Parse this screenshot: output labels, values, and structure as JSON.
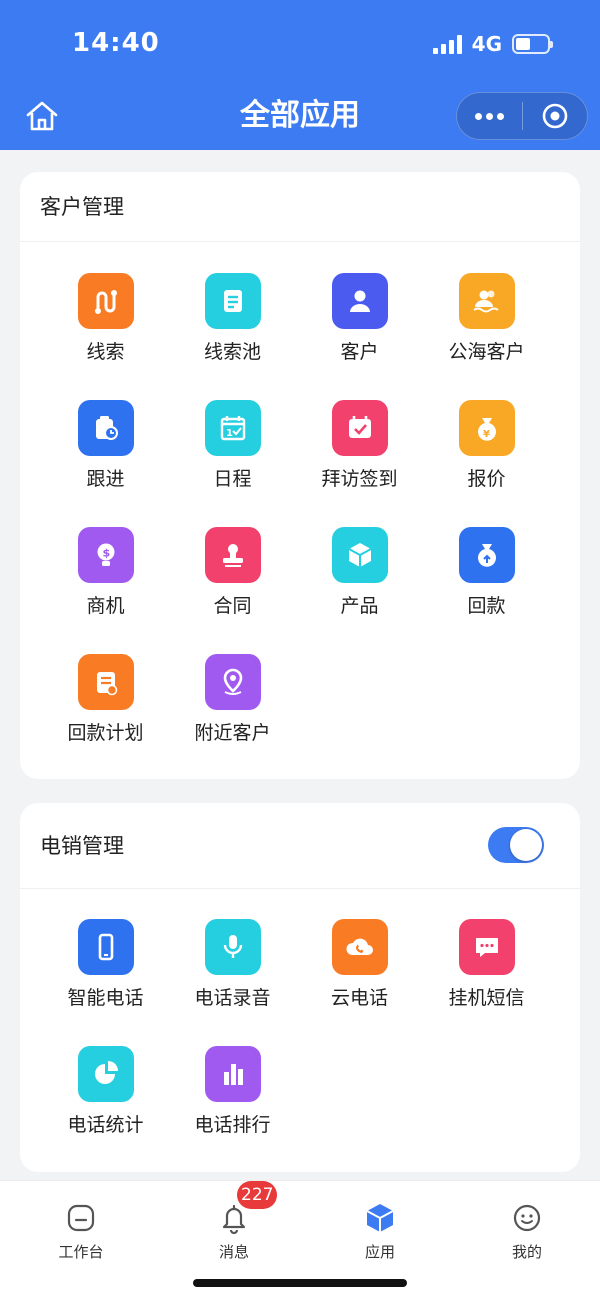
{
  "status_bar": {
    "time": "14:40",
    "network": "4G"
  },
  "header": {
    "title": "全部应用"
  },
  "colors": {
    "primary": "#3d7bf2",
    "orange": "#f97b24",
    "cyan": "#26cfdf",
    "indigo": "#4b5bf0",
    "amber": "#f9a825",
    "blue": "#2f72f0",
    "pink": "#f2416d",
    "purple": "#a05af0",
    "badge": "#e83a3a"
  },
  "sections": [
    {
      "title": "客户管理",
      "apps": [
        {
          "label": "线索",
          "icon": "route-icon",
          "color": "#f97b24"
        },
        {
          "label": "线索池",
          "icon": "clue-pool-icon",
          "color": "#26cfdf"
        },
        {
          "label": "客户",
          "icon": "customer-icon",
          "color": "#4b5bf0"
        },
        {
          "label": "公海客户",
          "icon": "public-customer-icon",
          "color": "#f9a825"
        },
        {
          "label": "跟进",
          "icon": "follow-up-icon",
          "color": "#2f72f0"
        },
        {
          "label": "日程",
          "icon": "calendar-icon",
          "color": "#26cfdf"
        },
        {
          "label": "拜访签到",
          "icon": "check-in-icon",
          "color": "#f2416d"
        },
        {
          "label": "报价",
          "icon": "quote-icon",
          "color": "#f9a825"
        },
        {
          "label": "商机",
          "icon": "opportunity-icon",
          "color": "#a05af0"
        },
        {
          "label": "合同",
          "icon": "contract-stamp-icon",
          "color": "#f2416d"
        },
        {
          "label": "产品",
          "icon": "product-box-icon",
          "color": "#26cfdf"
        },
        {
          "label": "回款",
          "icon": "payment-bag-icon",
          "color": "#2f72f0"
        },
        {
          "label": "回款计划",
          "icon": "payment-plan-icon",
          "color": "#f97b24"
        },
        {
          "label": "附近客户",
          "icon": "location-pin-icon",
          "color": "#a05af0"
        }
      ]
    },
    {
      "title": "电销管理",
      "toggle_on": true,
      "apps": [
        {
          "label": "智能电话",
          "icon": "smartphone-icon",
          "color": "#2f72f0"
        },
        {
          "label": "电话录音",
          "icon": "microphone-icon",
          "color": "#26cfdf"
        },
        {
          "label": "云电话",
          "icon": "cloud-phone-icon",
          "color": "#f97b24"
        },
        {
          "label": "挂机短信",
          "icon": "sms-icon",
          "color": "#f2416d"
        },
        {
          "label": "电话统计",
          "icon": "pie-chart-icon",
          "color": "#26cfdf"
        },
        {
          "label": "电话排行",
          "icon": "bar-chart-icon",
          "color": "#a05af0"
        }
      ]
    }
  ],
  "tabbar": [
    {
      "label": "工作台",
      "icon": "workbench-icon"
    },
    {
      "label": "消息",
      "icon": "bell-icon",
      "badge": "227"
    },
    {
      "label": "应用",
      "icon": "cube-icon",
      "active": true
    },
    {
      "label": "我的",
      "icon": "profile-face-icon"
    }
  ]
}
